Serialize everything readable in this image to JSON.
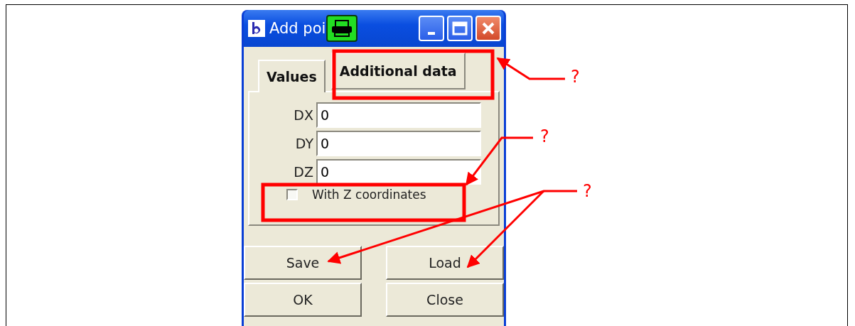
{
  "window": {
    "title": "Add poi"
  },
  "tabs": [
    {
      "label": "Values",
      "selected": true
    },
    {
      "label": "Additional data",
      "selected": false
    }
  ],
  "fields": [
    {
      "label": "DX",
      "value": "0"
    },
    {
      "label": "DY",
      "value": "0"
    },
    {
      "label": "DZ",
      "value": "0"
    }
  ],
  "checkbox": {
    "label": "With Z coordinates",
    "checked": false
  },
  "buttons": [
    "Save",
    "Load",
    "OK",
    "Close"
  ],
  "annotations": [
    {
      "text": "?"
    },
    {
      "text": "?"
    },
    {
      "text": "?"
    }
  ]
}
